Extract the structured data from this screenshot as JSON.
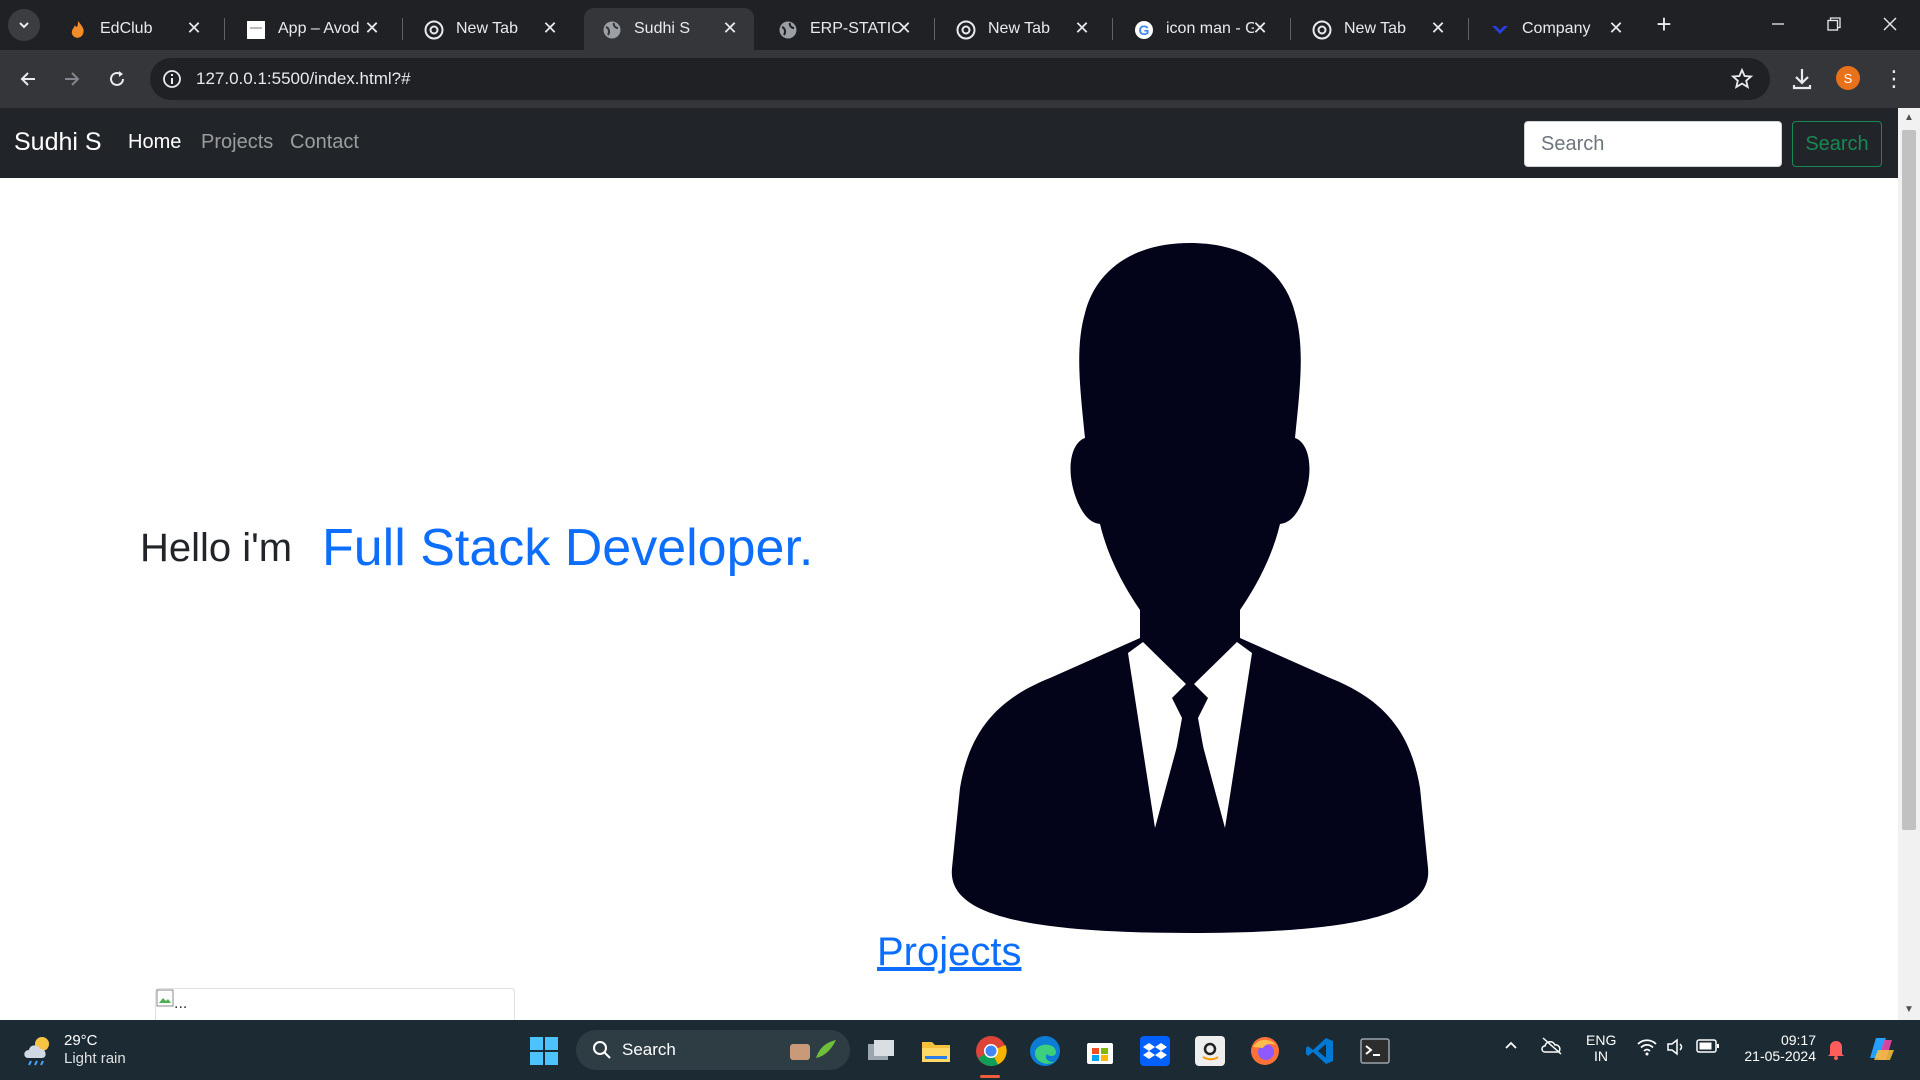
{
  "browser": {
    "tabs": [
      {
        "title": "EdClub",
        "icon": "edclub-icon",
        "active": false
      },
      {
        "title": "App – Avodha",
        "icon": "page-icon",
        "active": false
      },
      {
        "title": "New Tab",
        "icon": "chrome-icon",
        "active": false
      },
      {
        "title": "Sudhi S",
        "icon": "globe-icon",
        "active": true
      },
      {
        "title": "ERP-STATIC WEB",
        "icon": "globe-icon",
        "active": false
      },
      {
        "title": "New Tab",
        "icon": "chrome-icon",
        "active": false
      },
      {
        "title": "icon man - Google",
        "icon": "google-icon",
        "active": false
      },
      {
        "title": "New Tab",
        "icon": "chrome-icon",
        "active": false
      },
      {
        "title": "Company",
        "icon": "company-icon",
        "active": false
      }
    ],
    "url": "127.0.0.1:5500/index.html?#",
    "profile_initial": "S"
  },
  "site": {
    "brand": "Sudhi S",
    "nav": [
      {
        "label": "Home",
        "active": true
      },
      {
        "label": "Projects",
        "active": false
      },
      {
        "label": "Contact",
        "active": false
      }
    ],
    "search_placeholder": "Search",
    "search_button": "Search"
  },
  "hero": {
    "greeting": "Hello i'm",
    "role": "Full Stack Developer."
  },
  "projects": {
    "heading": "Projects",
    "card_image_alt": "..."
  },
  "taskbar": {
    "weather_temp": "29°C",
    "weather_condition": "Light rain",
    "search_label": "Search",
    "language_line1": "ENG",
    "language_line2": "IN",
    "time": "09:17",
    "date": "21-05-2024"
  },
  "colors": {
    "navbar_bg": "#212529",
    "accent_blue": "#0d6efd",
    "search_button_green": "#198754",
    "taskbar_bg": "#1c2b33",
    "browser_bg": "#202124"
  }
}
